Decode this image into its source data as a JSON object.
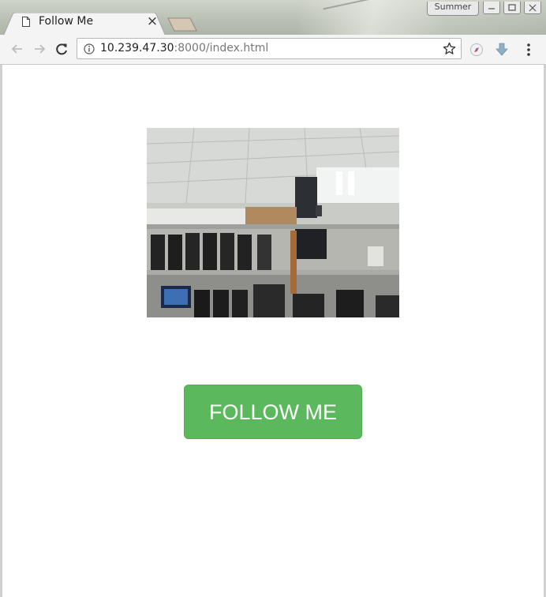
{
  "browser": {
    "tab": {
      "title": "Follow Me",
      "close_glyph": "×",
      "icon": "page-icon"
    },
    "profile_label": "Summer",
    "window_controls": [
      "minimize",
      "maximize",
      "close"
    ],
    "omnibox": {
      "url_host": "10.239.47.30",
      "url_rest": ":8000/index.html",
      "info_icon": "info-icon",
      "bookmark_icon": "star-icon"
    },
    "nav": {
      "back_icon": "back-arrow-icon",
      "forward_icon": "forward-arrow-icon",
      "reload_icon": "reload-icon"
    },
    "extensions": [
      "compass-extension-icon",
      "download-arrow-icon",
      "menu-kebab-icon"
    ]
  },
  "page": {
    "camera_feed": "camera-snapshot-image",
    "follow_button_label": "FOLLOW ME",
    "colors": {
      "button_bg": "#5cb85c",
      "button_border": "#4cae4c",
      "button_text": "#ffffff"
    }
  }
}
